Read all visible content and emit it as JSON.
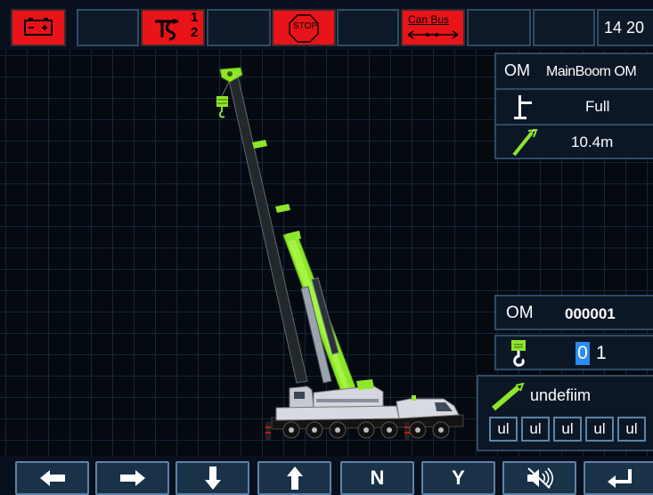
{
  "topbar": {
    "items": [
      {
        "icon": "battery-icon",
        "color": "#e8141a"
      },
      {
        "icon": "empty-slot"
      },
      {
        "icon": "hook-select-icon",
        "label_top": "1",
        "label_bottom": "2",
        "color": "#e8141a"
      },
      {
        "icon": "empty-slot"
      },
      {
        "icon": "stop-icon",
        "label": "STOP",
        "color": "#e8141a"
      },
      {
        "icon": "empty-slot"
      },
      {
        "icon": "can-bus-icon",
        "label": "Can Bus",
        "color": "#e8141a"
      },
      {
        "icon": "empty-slot"
      },
      {
        "icon": "empty-slot"
      }
    ],
    "clock": "14  20"
  },
  "info_panel": {
    "mode_label": "OM",
    "mode_value": "MainBoom OM",
    "outrigger_icon": "outrigger-icon",
    "outrigger_value": "Full",
    "boom_icon": "boom-length-icon",
    "boom_length": "10.4m"
  },
  "om_panel": {
    "label": "OM",
    "code": "000001"
  },
  "hook_panel": {
    "icon": "hook-icon",
    "digit_selected": "0",
    "digit_rest": "1"
  },
  "boom_panel": {
    "icon": "boom-icon",
    "label": "undefiim",
    "cells": [
      "ul",
      "ul",
      "ul",
      "ul",
      "ul"
    ]
  },
  "bottom_buttons": [
    {
      "name": "left-arrow-button",
      "icon": "arrow-left-icon"
    },
    {
      "name": "right-arrow-button",
      "icon": "arrow-right-icon"
    },
    {
      "name": "down-arrow-button",
      "icon": "arrow-down-icon"
    },
    {
      "name": "up-arrow-button",
      "icon": "arrow-up-icon"
    },
    {
      "name": "n-button",
      "label": "N"
    },
    {
      "name": "y-button",
      "label": "Y"
    },
    {
      "name": "mute-button",
      "icon": "speaker-mute-icon"
    },
    {
      "name": "enter-button",
      "icon": "enter-icon"
    }
  ],
  "colors": {
    "crane_green": "#8ee62a",
    "panel_border": "#2f4b66",
    "alarm_red": "#e8141a",
    "select_blue": "#2a8cf0"
  }
}
